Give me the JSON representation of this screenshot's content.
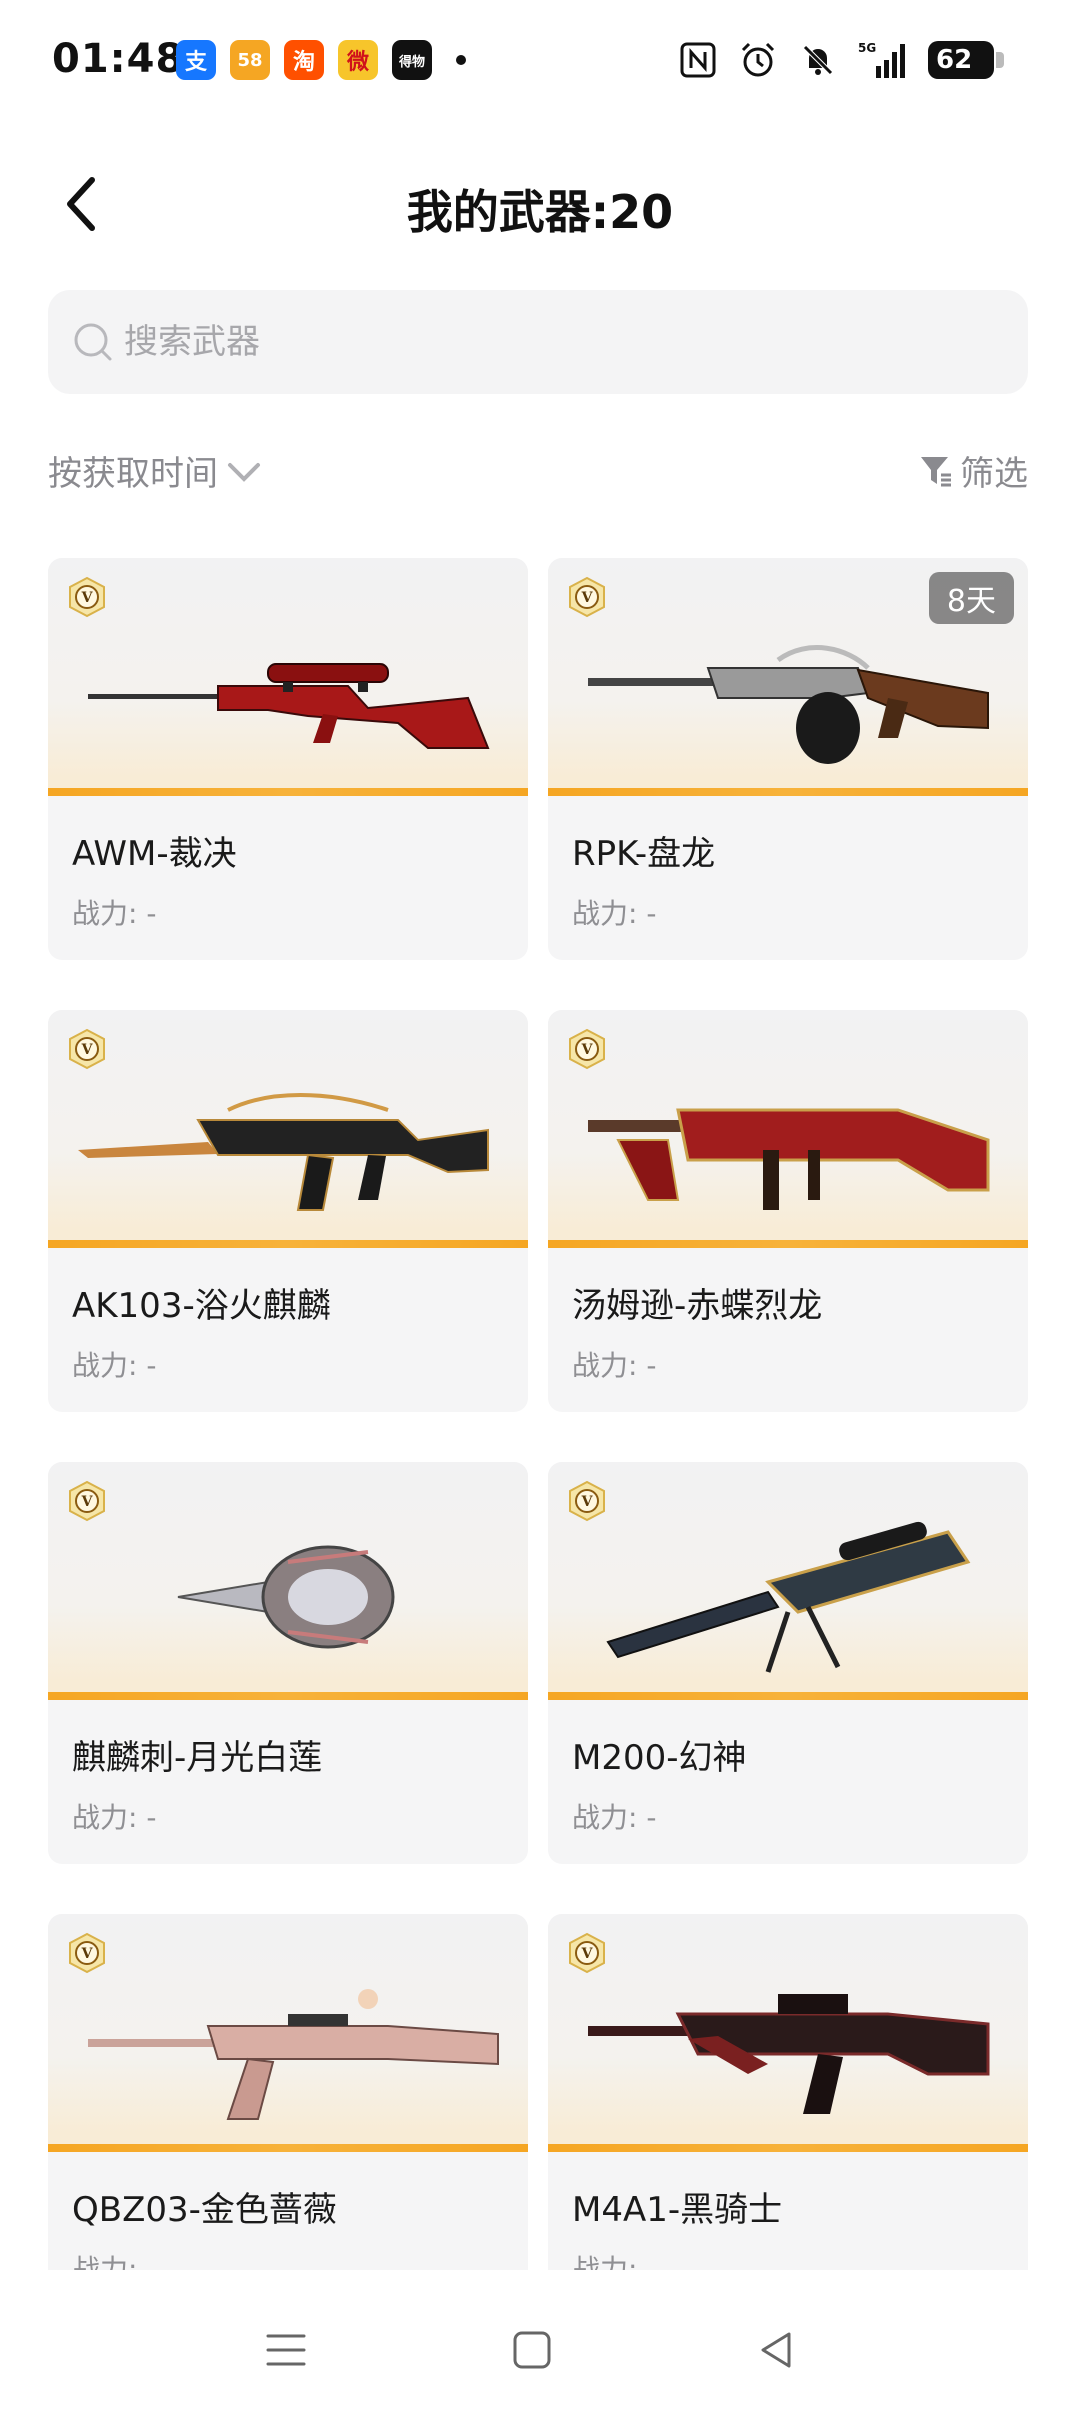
{
  "status": {
    "time": "01:48",
    "apps": [
      {
        "name": "alipay-icon",
        "glyph": "支",
        "color": "#1677ff"
      },
      {
        "name": "58-icon",
        "glyph": "58",
        "color": "#f5a623"
      },
      {
        "name": "taobao-icon",
        "glyph": "淘",
        "color": "#ff5000"
      },
      {
        "name": "weibo-icon",
        "glyph": "微",
        "color": "#f7c52b"
      },
      {
        "name": "dewu-icon",
        "glyph": "得物",
        "color": "#111111"
      }
    ],
    "battery": "62"
  },
  "header": {
    "title": "我的武器:20"
  },
  "search": {
    "placeholder": "搜索武器"
  },
  "sort": {
    "label": "按获取时间"
  },
  "filter": {
    "label": "筛选"
  },
  "weapons": [
    {
      "name": "AWM-裁决",
      "power": "战力: -",
      "badge": ""
    },
    {
      "name": "RPK-盘龙",
      "power": "战力: -",
      "badge": "8天"
    },
    {
      "name": "AK103-浴火麒麟",
      "power": "战力: -",
      "badge": ""
    },
    {
      "name": "汤姆逊-赤蝶烈龙",
      "power": "战力: -",
      "badge": ""
    },
    {
      "name": "麒麟刺-月光白莲",
      "power": "战力: -",
      "badge": ""
    },
    {
      "name": "M200-幻神",
      "power": "战力: -",
      "badge": ""
    },
    {
      "name": "QBZ03-金色蔷薇",
      "power": "战力: -",
      "badge": ""
    },
    {
      "name": "M4A1-黑骑士",
      "power": "战力: -",
      "badge": ""
    }
  ],
  "colors": {
    "accent": "#f5a623",
    "muted": "#8a8a8f"
  }
}
